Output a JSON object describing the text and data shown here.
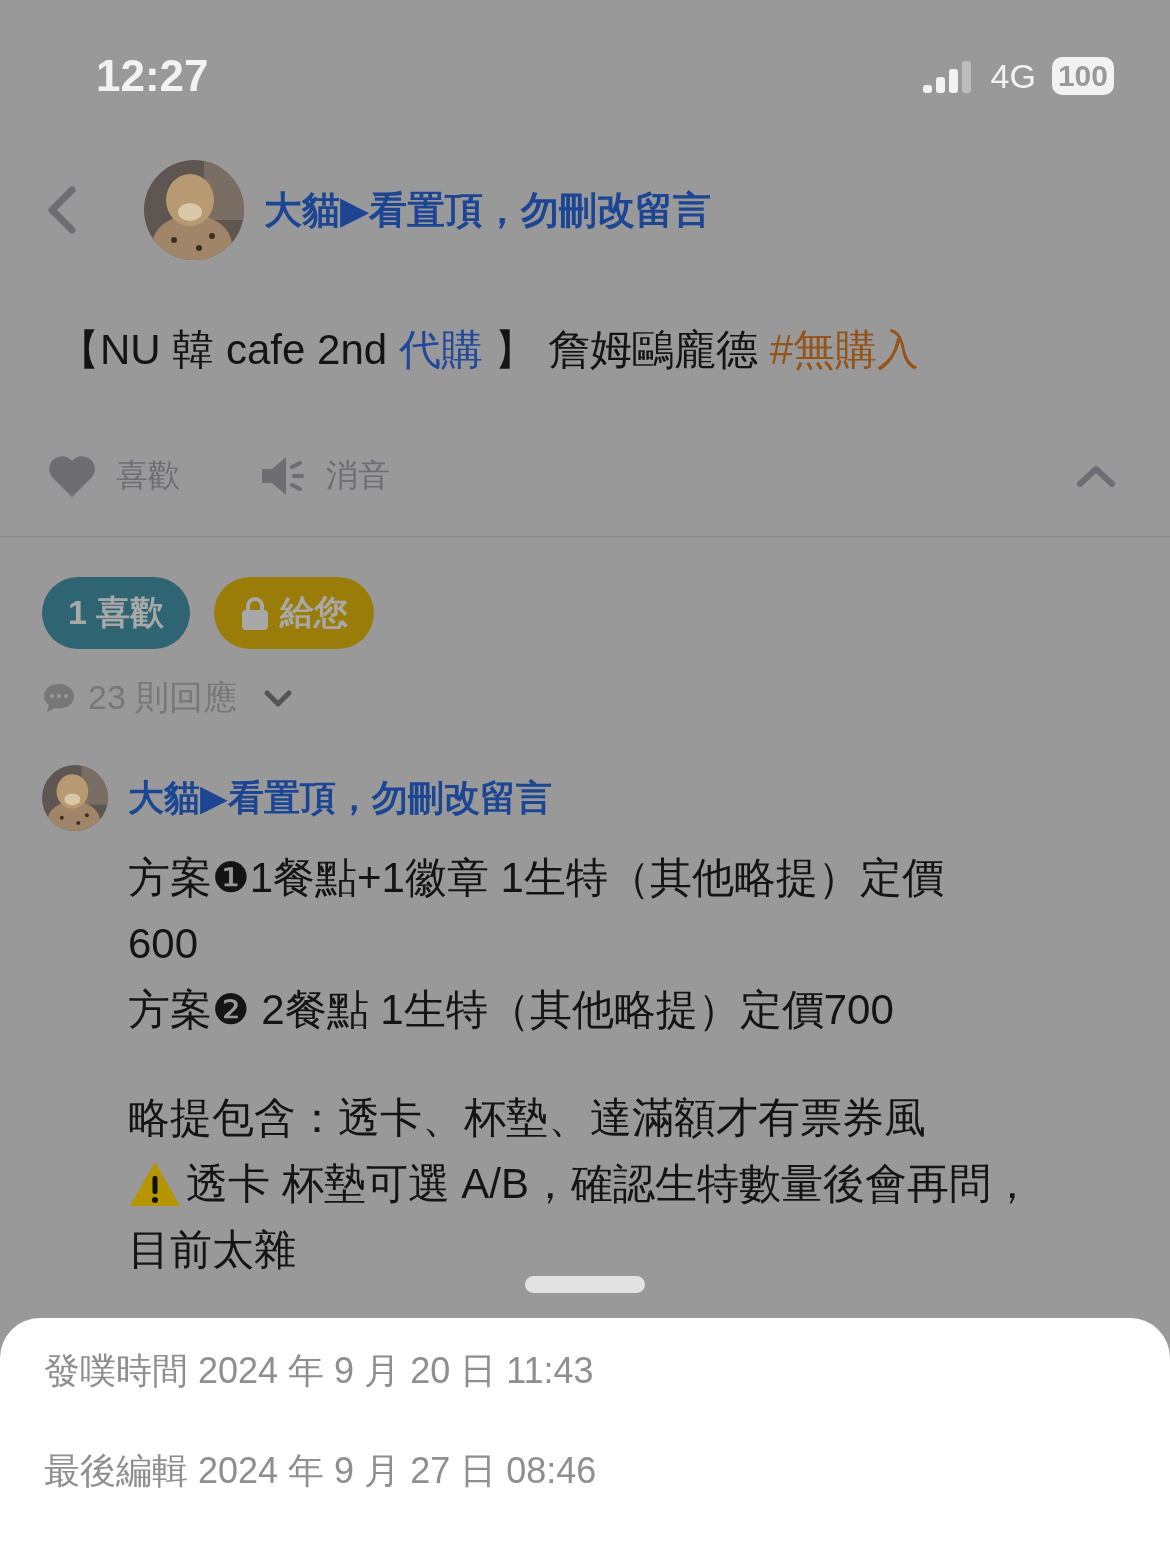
{
  "status_bar": {
    "time": "12:27",
    "network": "4G",
    "battery": "100"
  },
  "header": {
    "author": "大貓▶看置頂，勿刪改留言"
  },
  "post": {
    "title_parts": [
      {
        "text": "【NU 韓 cafe 2nd ",
        "kind": "plain"
      },
      {
        "text": "代購",
        "kind": "link"
      },
      {
        "text": " 】 詹姆鷗龐德 ",
        "kind": "plain"
      },
      {
        "text": "#無購入",
        "kind": "tag"
      }
    ]
  },
  "actions": [
    {
      "label": "喜歡",
      "kind": "like"
    },
    {
      "label": "消音",
      "kind": "mute"
    }
  ],
  "badges": [
    {
      "label": "1 喜歡",
      "kind": "likes"
    },
    {
      "label": "給您",
      "kind": "locked"
    }
  ],
  "replies": {
    "label": "23 則回應",
    "expanded": false
  },
  "comment": {
    "author": "大貓▶看置頂，勿刪改留言",
    "lines": [
      {
        "text": "方案❶1餐點+1徽章 1生特（其他略提）定價",
        "kind": "plain"
      },
      {
        "text": "600",
        "kind": "plain"
      },
      {
        "text": "方案❷ 2餐點 1生特（其他略提）定價700",
        "kind": "plain"
      },
      {
        "kind": "gap"
      },
      {
        "text": "略提包含：透卡、杯墊、達滿額才有票券風",
        "kind": "plain"
      },
      {
        "text": "透卡 杯墊可選 A/B，確認生特數量後會再問，",
        "kind": "warning"
      },
      {
        "text": "目前太雜",
        "kind": "plain"
      }
    ]
  },
  "sheet": {
    "rows": [
      {
        "label": "發噗時間",
        "value": "2024 年 9 月 20 日 11:43"
      },
      {
        "label": "最後編輯",
        "value": "2024 年 9 月 27 日 08:46"
      }
    ]
  }
}
